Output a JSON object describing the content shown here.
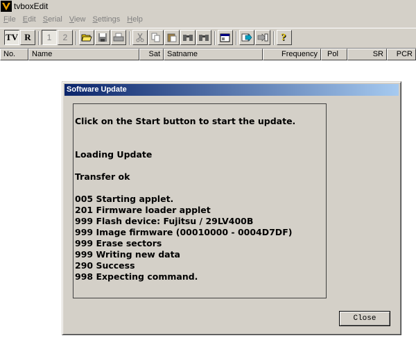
{
  "app": {
    "title": "tvboxEdit"
  },
  "menu": [
    {
      "u": "F",
      "rest": "ile"
    },
    {
      "u": "E",
      "rest": "dit"
    },
    {
      "u": "S",
      "rest": "erial"
    },
    {
      "u": "V",
      "rest": "iew"
    },
    {
      "u": "S",
      "rest": "ettings"
    },
    {
      "u": "H",
      "rest": "elp"
    }
  ],
  "toolbar": {
    "tv": "TV",
    "r": "R",
    "one": "1",
    "two": "2"
  },
  "columns": [
    "No.",
    "Name",
    "Sat",
    "Satname",
    "Frequency",
    "Pol",
    "SR",
    "PCR"
  ],
  "dialog": {
    "title": "Software Update",
    "lines": [
      "Click on the Start button to start the update.",
      "",
      "",
      "Loading Update",
      "",
      "Transfer ok",
      "",
      "005 Starting applet.",
      "201 Firmware loader applet",
      "999 Flash device: Fujitsu / 29LV400B",
      "999 Image firmware (00010000 - 0004D7DF)",
      "999 Erase sectors",
      "999 Writing new data",
      "290 Success",
      "998 Expecting command."
    ],
    "close_label": "Close"
  }
}
